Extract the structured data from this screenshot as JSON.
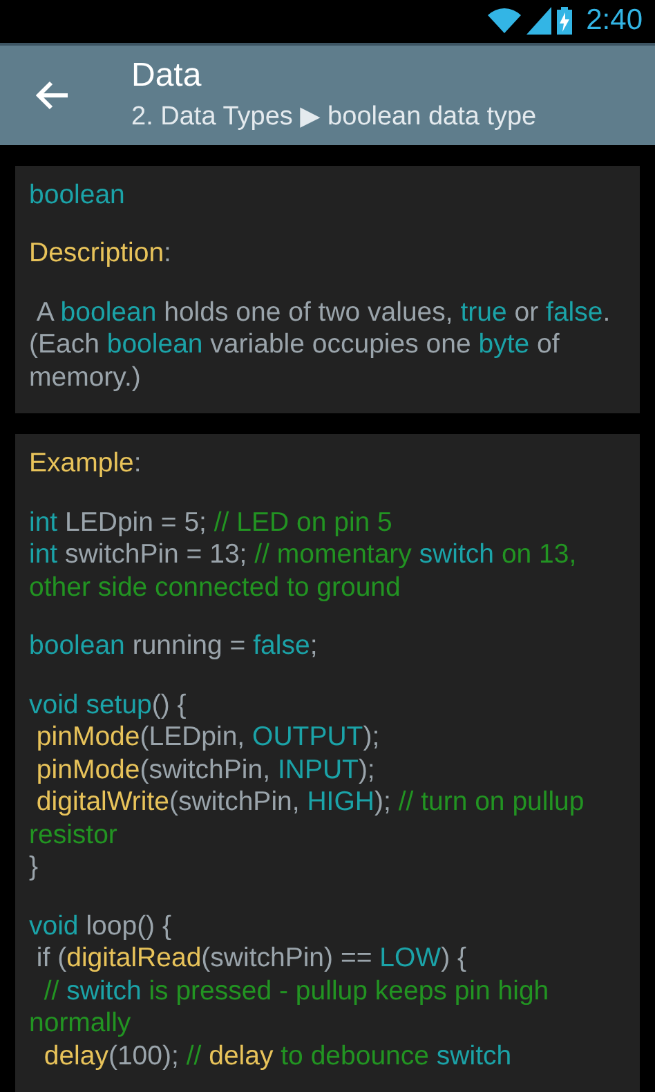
{
  "status_bar": {
    "time": "2:40"
  },
  "action_bar": {
    "title": "Data",
    "subtitle": "2. Data Types ▶ boolean data type"
  },
  "cards": [
    {
      "blocks": [
        [
          [
            {
              "t": "boolean",
              "kind": "kw"
            }
          ]
        ],
        [
          [
            {
              "t": "Description",
              "kind": "fn"
            },
            {
              "t": ":",
              "kind": "plain"
            }
          ]
        ],
        [
          [
            {
              "t": " A ",
              "kind": "plain"
            },
            {
              "t": "boolean",
              "kind": "kw"
            },
            {
              "t": " holds one of two values, ",
              "kind": "plain"
            },
            {
              "t": "true",
              "kind": "kw"
            },
            {
              "t": " or ",
              "kind": "plain"
            },
            {
              "t": "false",
              "kind": "kw"
            },
            {
              "t": ". (Each ",
              "kind": "plain"
            },
            {
              "t": "boolean",
              "kind": "kw"
            },
            {
              "t": " variable occupies one ",
              "kind": "plain"
            },
            {
              "t": "byte",
              "kind": "kw"
            },
            {
              "t": " of memory.)",
              "kind": "plain"
            }
          ]
        ]
      ]
    },
    {
      "blocks": [
        [
          [
            {
              "t": "Example",
              "kind": "fn"
            },
            {
              "t": ":",
              "kind": "plain"
            }
          ]
        ],
        [
          [
            {
              "t": "int",
              "kind": "kw"
            },
            {
              "t": " LEDpin = 5; ",
              "kind": "plain"
            },
            {
              "t": "// LED on pin 5",
              "kind": "comment"
            }
          ],
          [
            {
              "t": "int",
              "kind": "kw"
            },
            {
              "t": " switchPin = 13; ",
              "kind": "plain"
            },
            {
              "t": "// momentary ",
              "kind": "comment"
            },
            {
              "t": "switch",
              "kind": "kw"
            },
            {
              "t": " on 13, other side connected to ground",
              "kind": "comment"
            }
          ]
        ],
        [
          [
            {
              "t": "boolean",
              "kind": "kw"
            },
            {
              "t": " running = ",
              "kind": "plain"
            },
            {
              "t": "false",
              "kind": "kw"
            },
            {
              "t": ";",
              "kind": "plain"
            }
          ]
        ],
        [
          [
            {
              "t": "void setup",
              "kind": "kw"
            },
            {
              "t": "() {",
              "kind": "plain"
            }
          ],
          [
            {
              "t": " pinMode",
              "kind": "fn"
            },
            {
              "t": "(LEDpin, ",
              "kind": "plain"
            },
            {
              "t": "OUTPUT",
              "kind": "kw"
            },
            {
              "t": ");",
              "kind": "plain"
            }
          ],
          [
            {
              "t": " pinMode",
              "kind": "fn"
            },
            {
              "t": "(switchPin, ",
              "kind": "plain"
            },
            {
              "t": "INPUT",
              "kind": "kw"
            },
            {
              "t": ");",
              "kind": "plain"
            }
          ],
          [
            {
              "t": " digitalWrite",
              "kind": "fn"
            },
            {
              "t": "(switchPin, ",
              "kind": "plain"
            },
            {
              "t": "HIGH",
              "kind": "kw"
            },
            {
              "t": "); ",
              "kind": "plain"
            },
            {
              "t": "// turn on pullup resistor",
              "kind": "comment"
            }
          ],
          [
            {
              "t": "}",
              "kind": "plain"
            }
          ]
        ],
        [
          [
            {
              "t": "void",
              "kind": "kw"
            },
            {
              "t": " loop() {",
              "kind": "plain"
            }
          ],
          [
            {
              "t": " if (",
              "kind": "plain"
            },
            {
              "t": "digitalRead",
              "kind": "fn"
            },
            {
              "t": "(switchPin) == ",
              "kind": "plain"
            },
            {
              "t": "LOW",
              "kind": "kw"
            },
            {
              "t": ") {",
              "kind": "plain"
            }
          ],
          [
            {
              "t": "  // ",
              "kind": "comment"
            },
            {
              "t": "switch",
              "kind": "kw"
            },
            {
              "t": " is pressed - pullup keeps pin high normally",
              "kind": "comment"
            }
          ],
          [
            {
              "t": "  delay",
              "kind": "fn"
            },
            {
              "t": "(100); ",
              "kind": "plain"
            },
            {
              "t": "// ",
              "kind": "comment"
            },
            {
              "t": "delay",
              "kind": "fn"
            },
            {
              "t": " to debounce ",
              "kind": "comment"
            },
            {
              "t": "switch",
              "kind": "kw"
            }
          ]
        ]
      ]
    }
  ]
}
